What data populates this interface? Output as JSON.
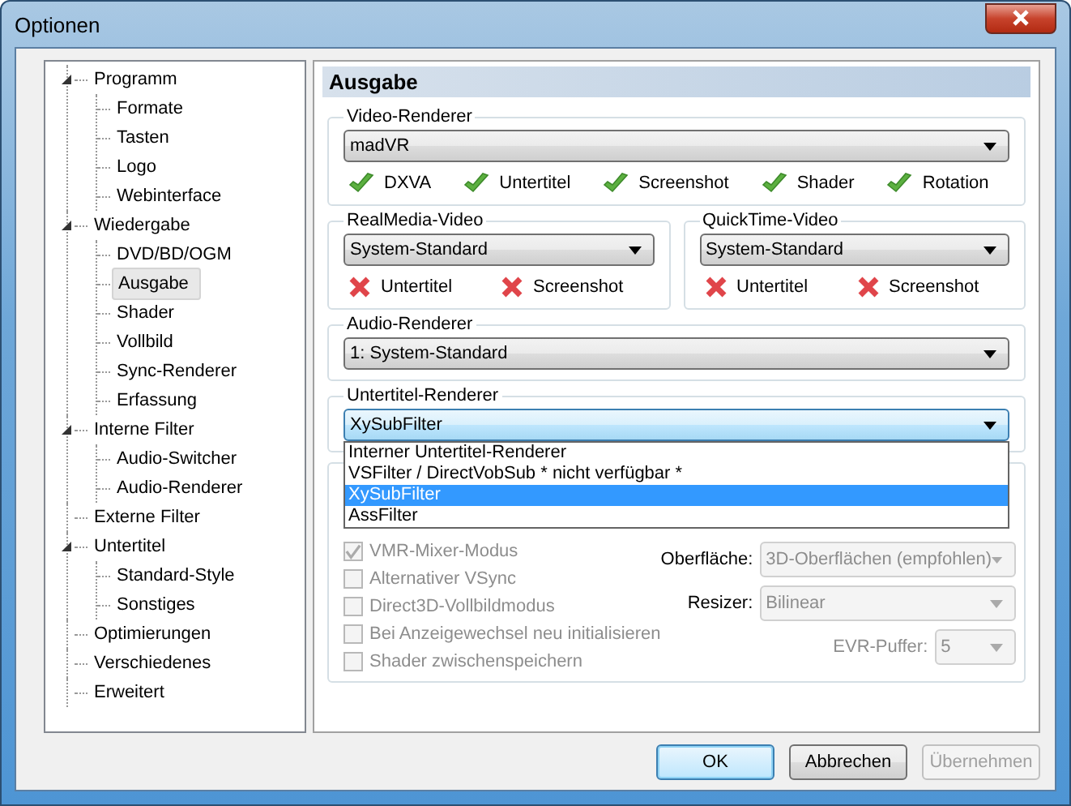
{
  "window": {
    "title": "Optionen"
  },
  "tree": [
    {
      "label": "Programm",
      "expanded": true,
      "selected": false,
      "children": [
        {
          "label": "Formate",
          "selected": false
        },
        {
          "label": "Tasten",
          "selected": false
        },
        {
          "label": "Logo",
          "selected": false
        },
        {
          "label": "Webinterface",
          "selected": false
        }
      ]
    },
    {
      "label": "Wiedergabe",
      "expanded": true,
      "selected": false,
      "children": [
        {
          "label": "DVD/BD/OGM",
          "selected": false
        },
        {
          "label": "Ausgabe",
          "selected": true
        },
        {
          "label": "Shader",
          "selected": false
        },
        {
          "label": "Vollbild",
          "selected": false
        },
        {
          "label": "Sync-Renderer",
          "selected": false
        },
        {
          "label": "Erfassung",
          "selected": false
        }
      ]
    },
    {
      "label": "Interne Filter",
      "expanded": true,
      "selected": false,
      "children": [
        {
          "label": "Audio-Switcher",
          "selected": false
        },
        {
          "label": "Audio-Renderer",
          "selected": false
        }
      ]
    },
    {
      "label": "Externe Filter",
      "selected": false
    },
    {
      "label": "Untertitel",
      "expanded": true,
      "selected": false,
      "children": [
        {
          "label": "Standard-Style",
          "selected": false
        },
        {
          "label": "Sonstiges",
          "selected": false
        }
      ]
    },
    {
      "label": "Optimierungen",
      "selected": false
    },
    {
      "label": "Verschiedenes",
      "selected": false
    },
    {
      "label": "Erweitert",
      "selected": false
    }
  ],
  "page_title": "Ausgabe",
  "video_renderer": {
    "title": "Video-Renderer",
    "value": "madVR",
    "features": [
      {
        "name": "DXVA",
        "supported": true
      },
      {
        "name": "Untertitel",
        "supported": true
      },
      {
        "name": "Screenshot",
        "supported": true
      },
      {
        "name": "Shader",
        "supported": true
      },
      {
        "name": "Rotation",
        "supported": true
      }
    ]
  },
  "sub_groups": [
    {
      "title": "RealMedia-Video",
      "value": "System-Standard",
      "features": [
        {
          "name": "Untertitel",
          "supported": false
        },
        {
          "name": "Screenshot",
          "supported": false
        }
      ]
    },
    {
      "title": "QuickTime-Video",
      "value": "System-Standard",
      "features": [
        {
          "name": "Untertitel",
          "supported": false
        },
        {
          "name": "Screenshot",
          "supported": false
        }
      ]
    }
  ],
  "audio_renderer": {
    "title": "Audio-Renderer",
    "value": "1: System-Standard"
  },
  "subtitle_renderer": {
    "title": "Untertitel-Renderer",
    "value": "XySubFilter",
    "open": true,
    "options": [
      {
        "label": "Interner Untertitel-Renderer",
        "selected": false
      },
      {
        "label": "VSFilter / DirectVobSub * nicht verfügbar *",
        "selected": false
      },
      {
        "label": "XySubFilter",
        "selected": true
      },
      {
        "label": "AssFilter",
        "selected": false
      }
    ]
  },
  "options": {
    "checkboxes": [
      {
        "label": "VMR-Mixer-Modus",
        "checked": true,
        "disabled": true
      },
      {
        "label": "Alternativer VSync",
        "checked": false,
        "disabled": true
      },
      {
        "label": "Direct3D-Vollbildmodus",
        "checked": false,
        "disabled": true
      },
      {
        "label": "Bei Anzeigewechsel neu initialisieren",
        "checked": false,
        "disabled": true
      },
      {
        "label": "Shader zwischenspeichern",
        "checked": false,
        "disabled": true
      }
    ],
    "selects": [
      {
        "label": "Oberfläche:",
        "value": "3D-Oberflächen (empfohlen)",
        "disabled": true
      },
      {
        "label": "Resizer:",
        "value": "Bilinear",
        "disabled": true
      },
      {
        "label": "EVR-Puffer:",
        "value": "5",
        "disabled": true
      }
    ]
  },
  "buttons": [
    {
      "label": "OK",
      "kind": "default",
      "disabled": false
    },
    {
      "label": "Abbrechen",
      "kind": "normal",
      "disabled": false
    },
    {
      "label": "Übernehmen",
      "kind": "normal",
      "disabled": true
    }
  ]
}
